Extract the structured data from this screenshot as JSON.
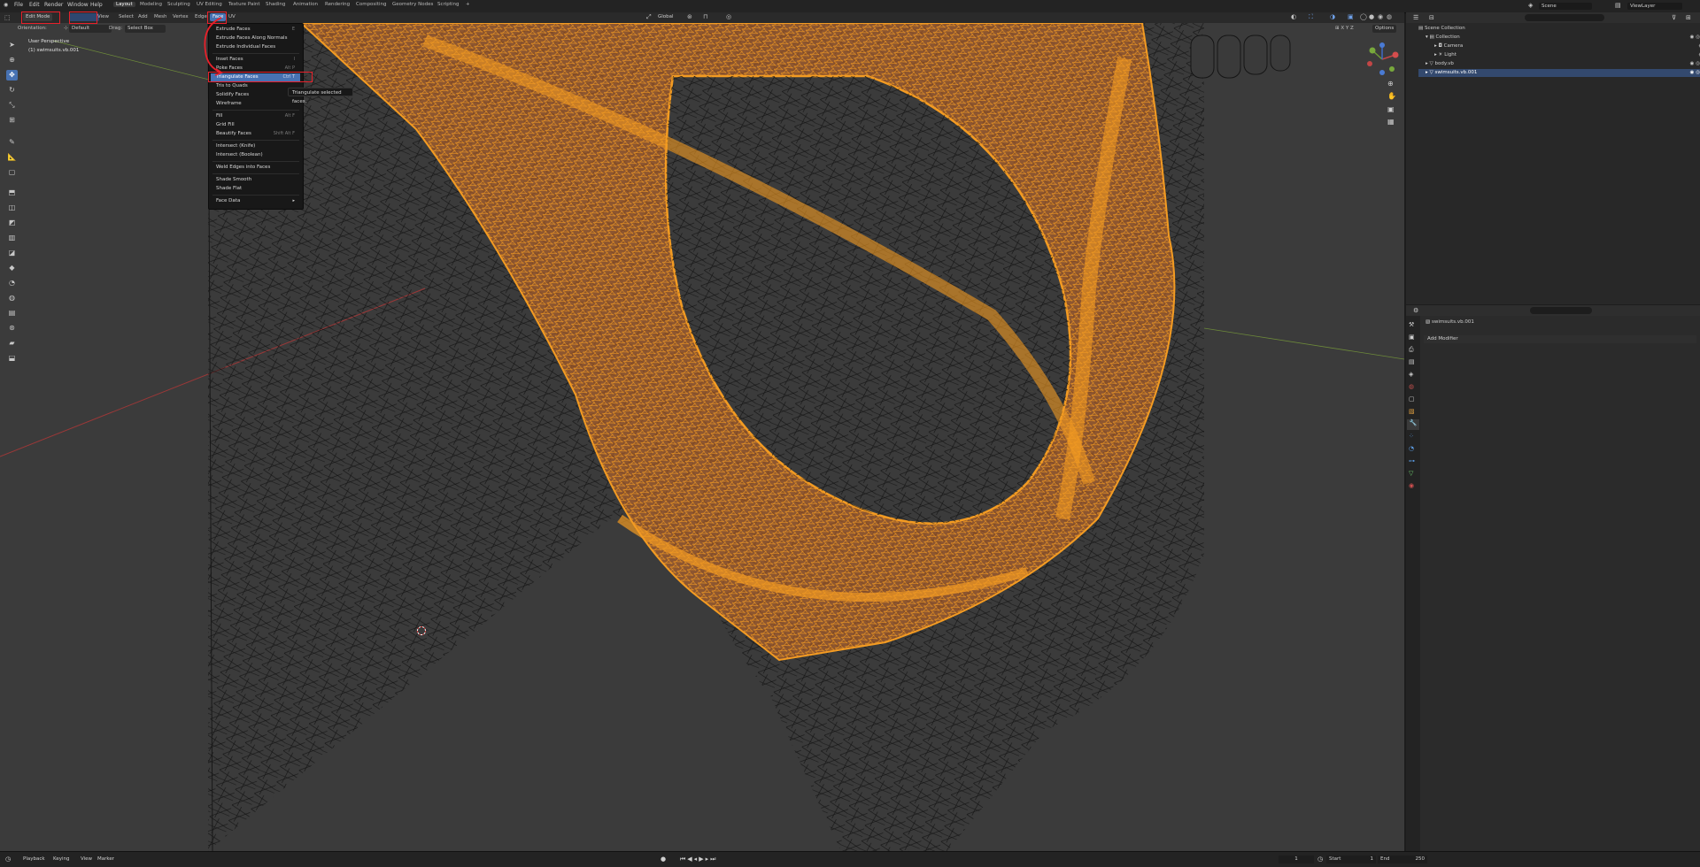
{
  "app": {
    "menu": [
      "File",
      "Edit",
      "Render",
      "Window",
      "Help"
    ],
    "workspace_tabs": [
      "Layout",
      "Modeling",
      "Sculpting",
      "UV Editing",
      "Texture Paint",
      "Shading",
      "Animation",
      "Rendering",
      "Compositing",
      "Geometry Nodes",
      "Scripting"
    ],
    "active_tab": "Layout",
    "add_tab": "+",
    "scene": "Scene",
    "view_layer": "ViewLayer"
  },
  "viewport_header": {
    "mode": "Edit Mode",
    "menus": [
      "View",
      "Select",
      "Add",
      "Mesh",
      "Vertex",
      "Edge",
      "Face",
      "UV"
    ],
    "active_menu": "Face",
    "transform_orientation": "Global",
    "options": "Options"
  },
  "tool_settings": {
    "orientation_label": "Orientation:",
    "orientation_value": "Default",
    "drag_label": "Drag:",
    "drag_value": "Select Box"
  },
  "viewport_info": {
    "perspective": "User Perspective",
    "object": "(1) swimsuits.vb.001"
  },
  "face_menu": {
    "items": [
      {
        "label": "Extrude Faces",
        "shortcut": "E"
      },
      {
        "label": "Extrude Faces Along Normals",
        "shortcut": ""
      },
      {
        "label": "Extrude Individual Faces",
        "shortcut": ""
      },
      {
        "label": "Inset Faces",
        "shortcut": "I"
      },
      {
        "label": "Poke Faces",
        "shortcut": "Alt P"
      },
      {
        "label": "Triangulate Faces",
        "shortcut": "Ctrl T"
      },
      {
        "label": "Tris to Quads",
        "shortcut": ""
      },
      {
        "label": "Solidify Faces",
        "shortcut": ""
      },
      {
        "label": "Wireframe",
        "shortcut": ""
      },
      {
        "label": "Fill",
        "shortcut": "Alt F"
      },
      {
        "label": "Grid Fill",
        "shortcut": ""
      },
      {
        "label": "Beautify Faces",
        "shortcut": "Shift Alt F"
      },
      {
        "label": "Intersect (Knife)",
        "shortcut": ""
      },
      {
        "label": "Intersect (Boolean)",
        "shortcut": ""
      },
      {
        "label": "Weld Edges into Faces",
        "shortcut": ""
      },
      {
        "label": "Shade Smooth",
        "shortcut": ""
      },
      {
        "label": "Shade Flat",
        "shortcut": ""
      },
      {
        "label": "Face Data",
        "shortcut": "▸"
      }
    ],
    "highlighted": "Triangulate Faces",
    "tooltip": "Triangulate selected faces."
  },
  "outliner": {
    "root": "Scene Collection",
    "items": [
      {
        "label": "Collection",
        "depth": 1
      },
      {
        "label": "Camera",
        "depth": 2
      },
      {
        "label": "Light",
        "depth": 2
      },
      {
        "label": "body.vb",
        "depth": 1
      },
      {
        "label": "swimsuits.vb.001",
        "depth": 1
      }
    ],
    "selected": "swimsuits.vb.001"
  },
  "properties": {
    "object": "swimsuits.vb.001",
    "add_modifier": "Add Modifier"
  },
  "timeline": {
    "menus": [
      "Playback",
      "Keying",
      "View",
      "Marker"
    ],
    "current_frame": "1",
    "start_label": "Start",
    "start": "1",
    "end_label": "End",
    "end": "250"
  },
  "colors": {
    "accent": "#4772b3",
    "wire_selected": "#f39b22",
    "wire_unselected": "#111111",
    "annotation_red": "#e8202a"
  }
}
